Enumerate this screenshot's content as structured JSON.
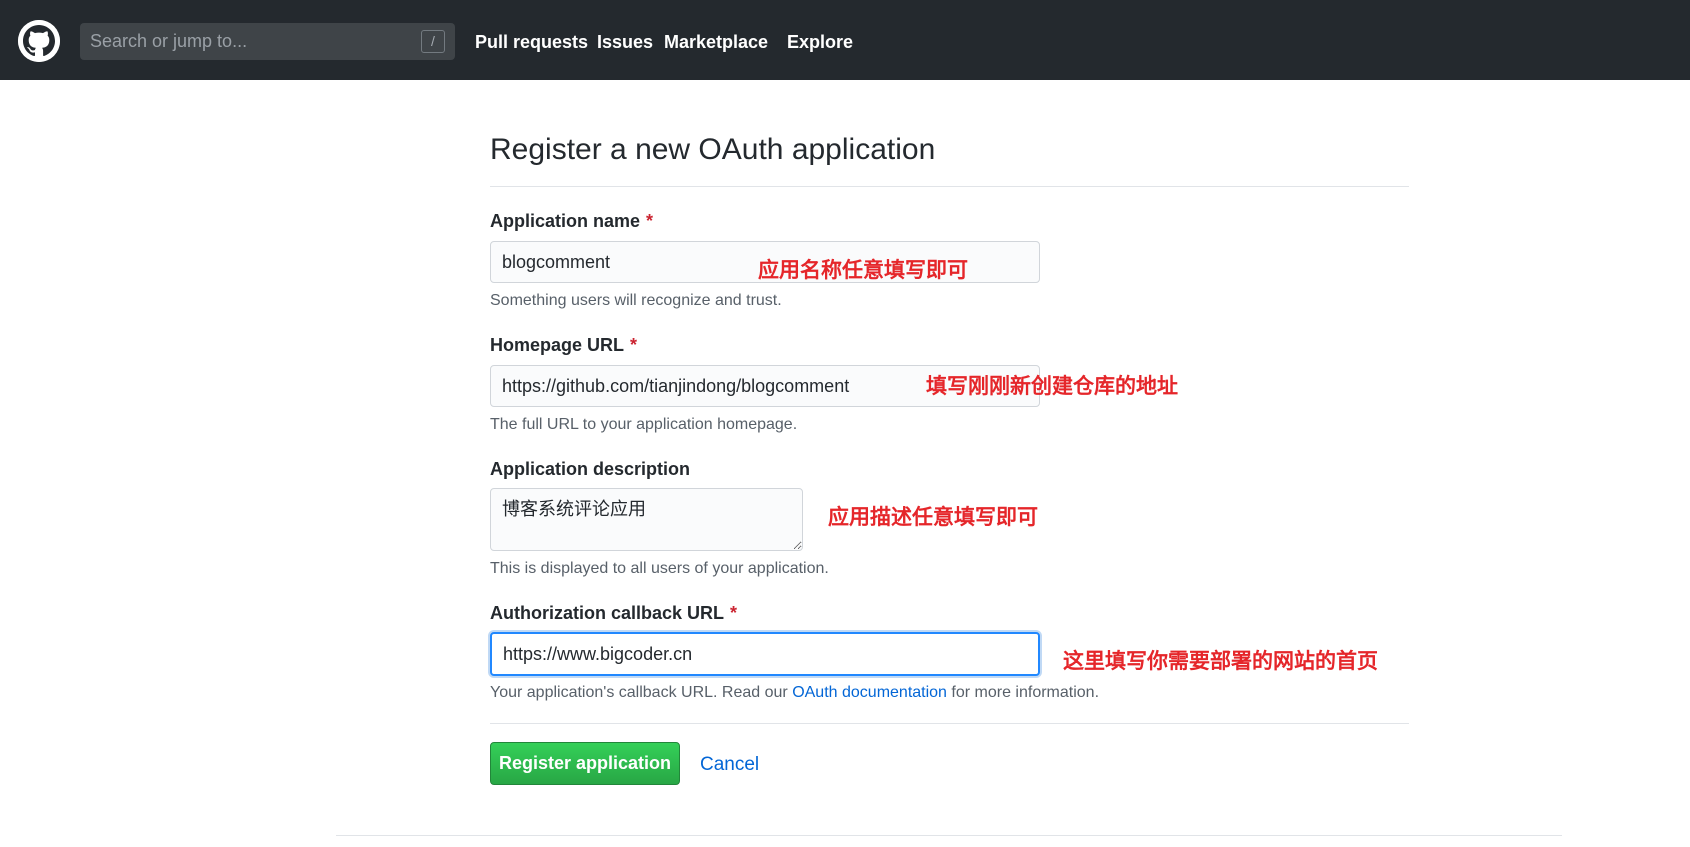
{
  "header": {
    "logo_icon": "github-octocat-icon",
    "search": {
      "placeholder": "Search or jump to...",
      "shortcut": "/"
    },
    "nav": [
      "Pull requests",
      "Issues",
      "Marketplace",
      "Explore"
    ]
  },
  "form": {
    "title": "Register a new OAuth application",
    "required_mark": "*",
    "app_name": {
      "label": "Application name",
      "value": "blogcomment",
      "note": "Something users will recognize and trust.",
      "annotation": "应用名称任意填写即可"
    },
    "homepage_url": {
      "label": "Homepage URL",
      "value": "https://github.com/tianjindong/blogcomment",
      "note": "The full URL to your application homepage.",
      "annotation": "填写刚刚新创建仓库的地址"
    },
    "description": {
      "label": "Application description",
      "value": "博客系统评论应用",
      "note": "This is displayed to all users of your application.",
      "annotation": "应用描述任意填写即可"
    },
    "callback_url": {
      "label": "Authorization callback URL",
      "value": "https://www.bigcoder.cn",
      "note_before": "Your application's callback URL. Read our ",
      "note_link": "OAuth documentation",
      "note_after": " for more information.",
      "annotation": "这里填写你需要部署的网站的首页"
    },
    "register_label": "Register application",
    "cancel_label": "Cancel"
  },
  "colors": {
    "header_bg": "#24292e",
    "annotation": "#e5262a",
    "primary_button": "#28a745",
    "link": "#0366d6",
    "required": "#cb2431"
  }
}
